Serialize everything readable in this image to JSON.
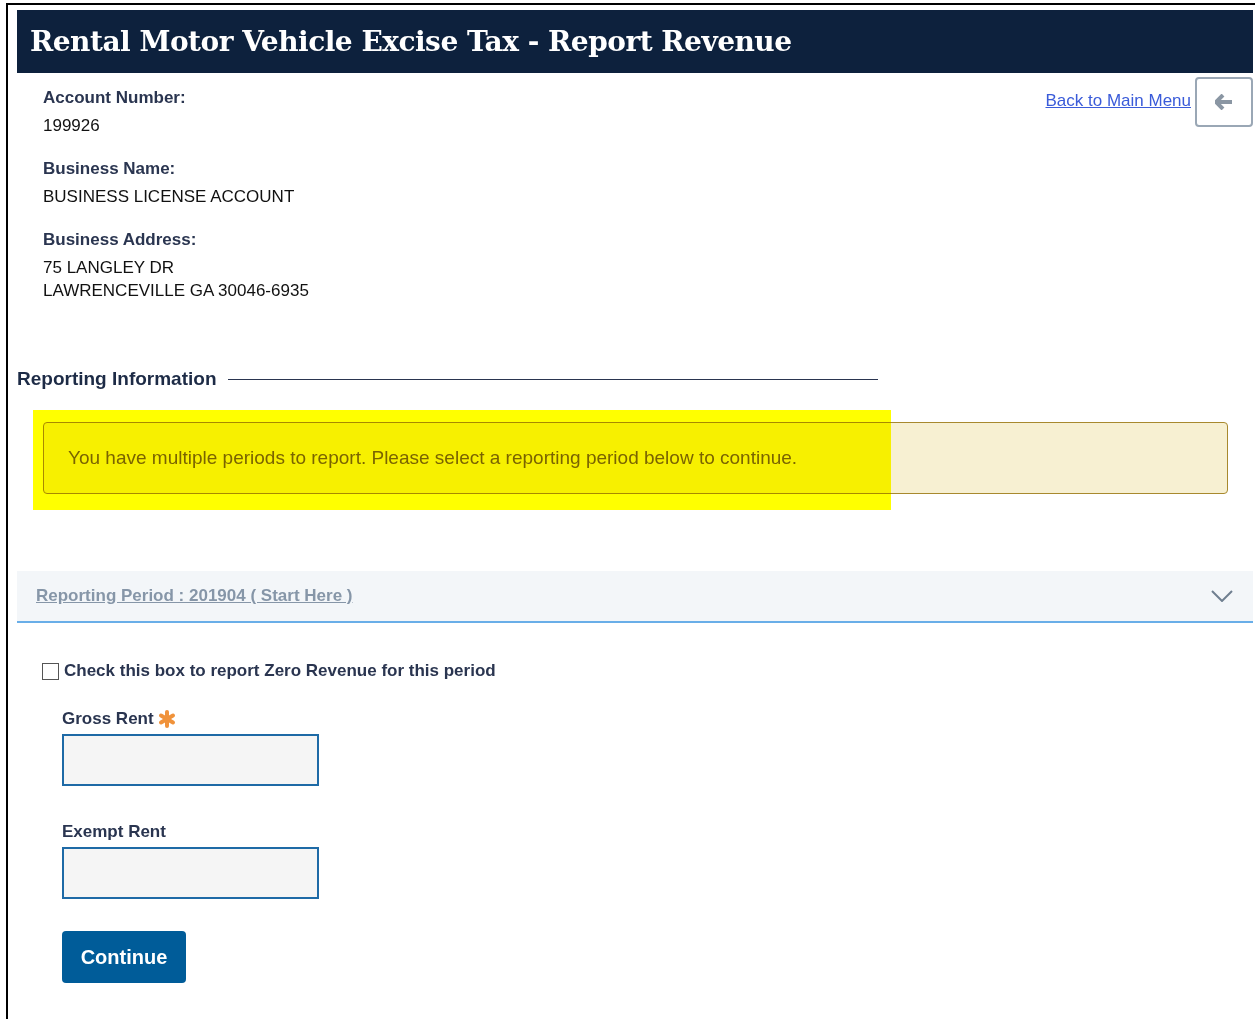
{
  "header": {
    "title": "Rental Motor Vehicle Excise Tax - Report Revenue"
  },
  "account": {
    "fields": [
      {
        "label": "Account Number:",
        "lines": [
          "199926"
        ]
      },
      {
        "label": "Business Name:",
        "lines": [
          "BUSINESS LICENSE ACCOUNT"
        ]
      },
      {
        "label": "Business Address:",
        "lines": [
          "75 LANGLEY DR",
          "LAWRENCEVILLE GA 30046-6935"
        ]
      }
    ],
    "back_link": "Back to Main Menu"
  },
  "reporting": {
    "heading": "Reporting Information",
    "alert": {
      "text": "You have multiple periods to report. Please select a reporting period below to continue.",
      "highlighted": true
    },
    "period": {
      "label": "Reporting Period : 201904 ( Start Here )",
      "expanded": true
    },
    "zero_revenue": {
      "label": "Check this box to report Zero Revenue for this period",
      "checked": false
    },
    "inputs": [
      {
        "label": "Gross Rent",
        "required": true
      },
      {
        "label": "Exempt Rent",
        "required": false
      }
    ],
    "submit": "Continue"
  }
}
